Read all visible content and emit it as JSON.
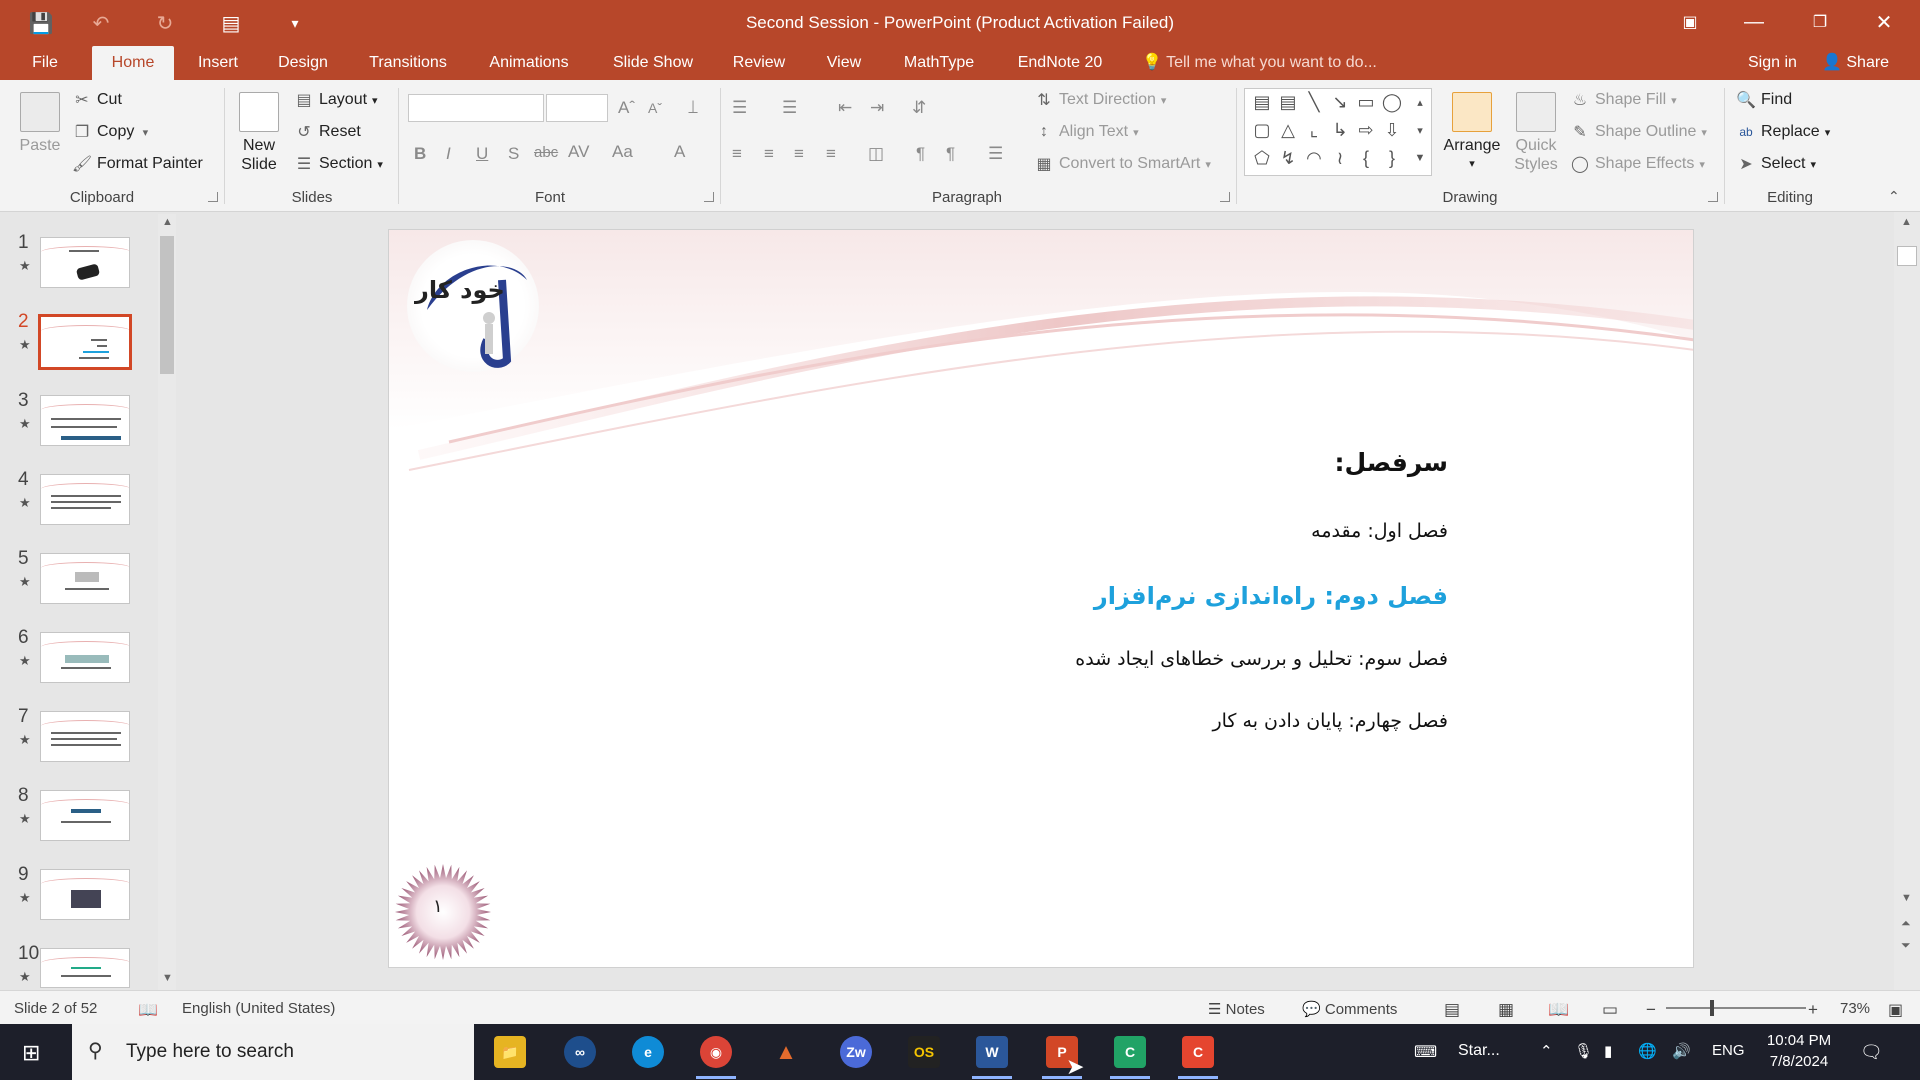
{
  "window": {
    "title": "Second Session - PowerPoint (Product Activation Failed)"
  },
  "tabs": [
    {
      "label": "File"
    },
    {
      "label": "Home"
    },
    {
      "label": "Insert"
    },
    {
      "label": "Design"
    },
    {
      "label": "Transitions"
    },
    {
      "label": "Animations"
    },
    {
      "label": "Slide Show"
    },
    {
      "label": "Review"
    },
    {
      "label": "View"
    },
    {
      "label": "MathType"
    },
    {
      "label": "EndNote 20"
    }
  ],
  "tellme": "Tell me what you want to do...",
  "account": {
    "signin": "Sign in",
    "share": "Share"
  },
  "ribbon": {
    "clipboard": {
      "paste": "Paste",
      "cut": "Cut",
      "copy": "Copy",
      "format_painter": "Format Painter",
      "label": "Clipboard"
    },
    "slides": {
      "new_slide_1": "New",
      "new_slide_2": "Slide",
      "layout": "Layout",
      "reset": "Reset",
      "section": "Section",
      "label": "Slides"
    },
    "font": {
      "label": "Font",
      "bold": "B",
      "italic": "I",
      "underline": "U",
      "shadow": "S",
      "strike": "abc",
      "case": "Aa"
    },
    "paragraph": {
      "text_direction": "Text Direction",
      "align_text": "Align Text",
      "convert_smartart": "Convert to SmartArt",
      "label": "Paragraph"
    },
    "drawing": {
      "arrange": "Arrange",
      "quick_styles_1": "Quick",
      "quick_styles_2": "Styles",
      "shape_fill": "Shape Fill",
      "shape_outline": "Shape Outline",
      "shape_effects": "Shape Effects",
      "label": "Drawing"
    },
    "editing": {
      "find": "Find",
      "replace": "Replace",
      "select": "Select",
      "label": "Editing"
    }
  },
  "thumbnails": [
    {
      "num": "1"
    },
    {
      "num": "2"
    },
    {
      "num": "3"
    },
    {
      "num": "4"
    },
    {
      "num": "5"
    },
    {
      "num": "6"
    },
    {
      "num": "7"
    },
    {
      "num": "8"
    },
    {
      "num": "9"
    },
    {
      "num": "10"
    }
  ],
  "slide": {
    "logo_text": "خود کار",
    "heading": "سرفصل:",
    "chapter1": "فصل اول: مقدمه",
    "chapter2": "فصل دوم: راه‌اندازی نرم‌افزار",
    "chapter3": "فصل سوم: تحلیل و بررسی خطاهای ایجاد شده",
    "chapter4": "فصل چهارم: پایان دادن به کار",
    "page_number": "۱",
    "accent_color": "#1ea1dc"
  },
  "status": {
    "slide_info": "Slide 2 of 52",
    "language": "English (United States)",
    "notes": "Notes",
    "comments": "Comments",
    "zoom": "73%"
  },
  "taskbar": {
    "search_placeholder": "Type here to search",
    "start_label": "Star...",
    "lang": "ENG",
    "time": "10:04 PM",
    "date": "7/8/2024"
  }
}
